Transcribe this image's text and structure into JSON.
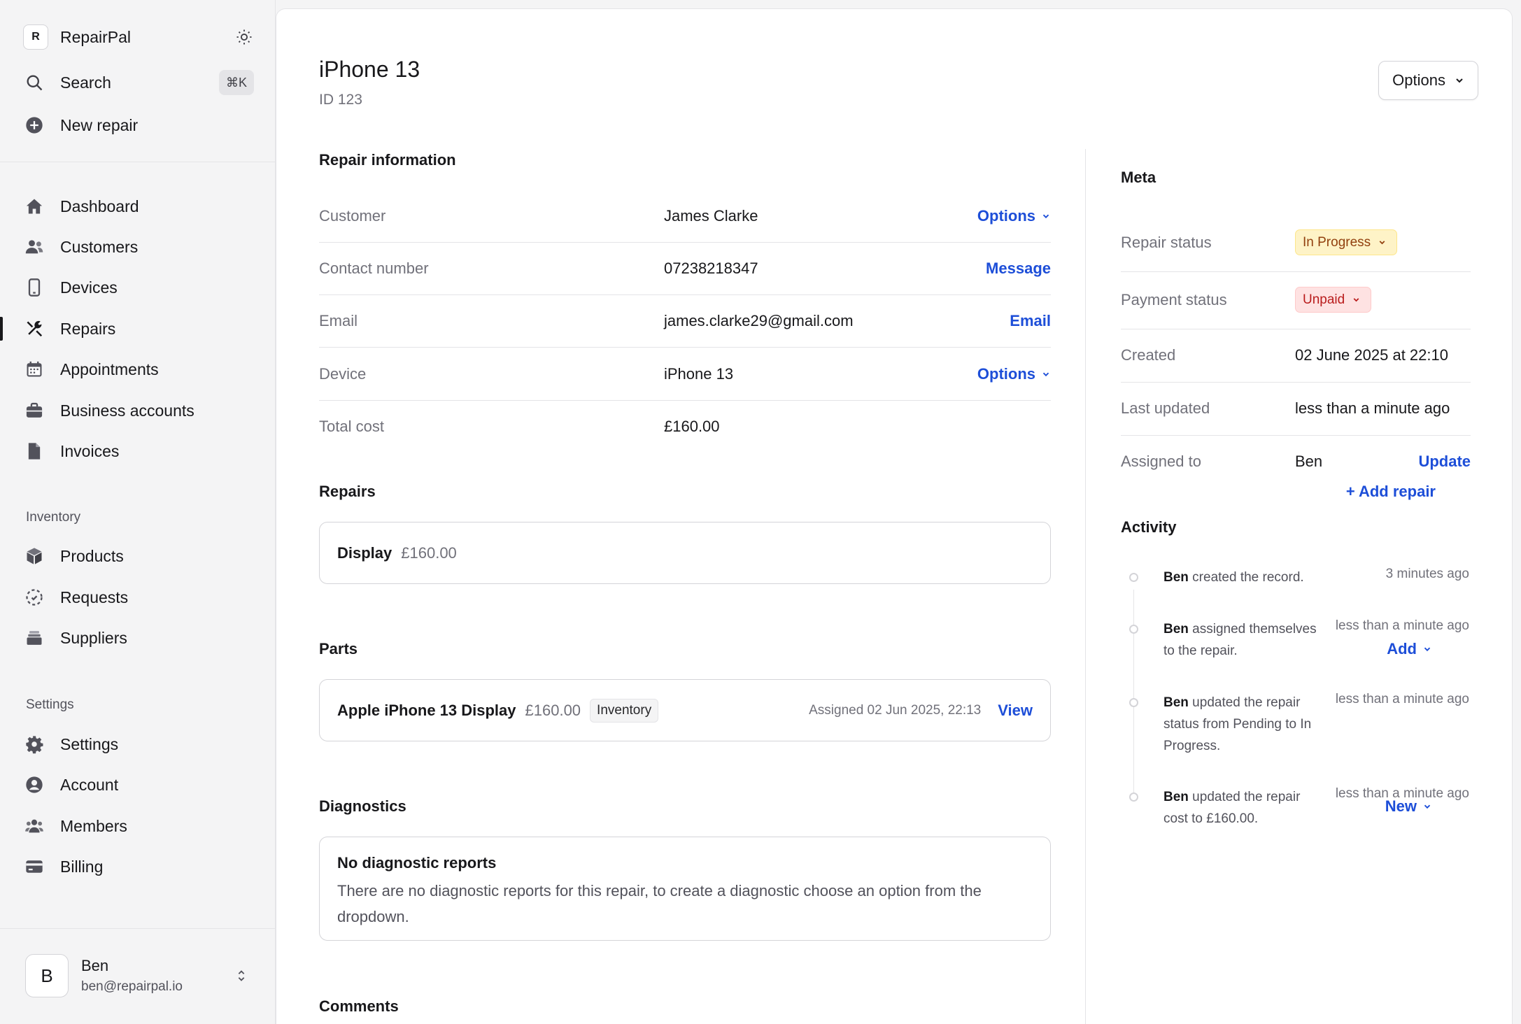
{
  "app": {
    "name": "RepairPal",
    "logo_letter": "R"
  },
  "sidebar": {
    "search_label": "Search",
    "search_shortcut": "⌘K",
    "new_repair_label": "New repair",
    "nav": [
      {
        "label": "Dashboard",
        "icon": "home-icon"
      },
      {
        "label": "Customers",
        "icon": "users-icon"
      },
      {
        "label": "Devices",
        "icon": "phone-icon"
      },
      {
        "label": "Repairs",
        "icon": "wrench-icon",
        "active": true
      },
      {
        "label": "Appointments",
        "icon": "calendar-icon"
      },
      {
        "label": "Business accounts",
        "icon": "briefcase-icon"
      },
      {
        "label": "Invoices",
        "icon": "document-icon"
      }
    ],
    "inventory_label": "Inventory",
    "inventory": [
      {
        "label": "Products",
        "icon": "cube-icon"
      },
      {
        "label": "Requests",
        "icon": "dashed-circle-icon"
      },
      {
        "label": "Suppliers",
        "icon": "stack-icon"
      }
    ],
    "settings_label": "Settings",
    "settings": [
      {
        "label": "Settings",
        "icon": "gear-icon"
      },
      {
        "label": "Account",
        "icon": "user-circle-icon"
      },
      {
        "label": "Members",
        "icon": "user-group-icon"
      },
      {
        "label": "Billing",
        "icon": "credit-card-icon"
      }
    ],
    "user": {
      "initial": "B",
      "name": "Ben",
      "email": "ben@repairpal.io"
    }
  },
  "header": {
    "title": "iPhone 13",
    "id_label": "ID 123",
    "options_label": "Options"
  },
  "repair_info": {
    "title": "Repair information",
    "rows": [
      {
        "key": "Customer",
        "value": "James Clarke",
        "action": "Options",
        "dropdown": true
      },
      {
        "key": "Contact number",
        "value": "07238218347",
        "action": "Message"
      },
      {
        "key": "Email",
        "value": "james.clarke29@gmail.com",
        "action": "Email"
      },
      {
        "key": "Device",
        "value": "iPhone 13",
        "action": "Options",
        "dropdown": true
      },
      {
        "key": "Total cost",
        "value": "£160.00",
        "action": ""
      }
    ]
  },
  "repairs": {
    "title": "Repairs",
    "add_label": "+ Add repair",
    "items": [
      {
        "name": "Display",
        "price": "£160.00"
      }
    ]
  },
  "parts": {
    "title": "Parts",
    "add_label": "Add",
    "items": [
      {
        "name": "Apple iPhone 13 Display",
        "price": "£160.00",
        "tag": "Inventory",
        "assigned": "Assigned 02 Jun 2025, 22:13",
        "view_label": "View"
      }
    ]
  },
  "diagnostics": {
    "title": "Diagnostics",
    "new_label": "New",
    "empty_title": "No diagnostic reports",
    "empty_desc": "There are no diagnostic reports for this repair, to create a diagnostic choose an option from the dropdown."
  },
  "comments": {
    "title": "Comments"
  },
  "meta": {
    "title": "Meta",
    "repair_status_label": "Repair status",
    "repair_status": "In Progress",
    "payment_status_label": "Payment status",
    "payment_status": "Unpaid",
    "created_label": "Created",
    "created": "02 June 2025 at 22:10",
    "updated_label": "Last updated",
    "updated": "less than a minute ago",
    "assigned_label": "Assigned to",
    "assigned": "Ben",
    "update_label": "Update",
    "colors": {
      "in_progress_bg": "#fef3c7",
      "unpaid_bg": "#fee2e2",
      "link": "#1d4ed8"
    }
  },
  "activity": {
    "title": "Activity",
    "items": [
      {
        "actor": "Ben",
        "text": " created the record.",
        "time": "3 minutes ago"
      },
      {
        "actor": "Ben",
        "text": " assigned themselves to the repair.",
        "time": "less than a minute ago"
      },
      {
        "actor": "Ben",
        "text": " updated the repair status from Pending to In Progress.",
        "time": "less than a minute ago"
      },
      {
        "actor": "Ben",
        "text": " updated the repair cost to £160.00.",
        "time": "less than a minute ago"
      }
    ]
  }
}
